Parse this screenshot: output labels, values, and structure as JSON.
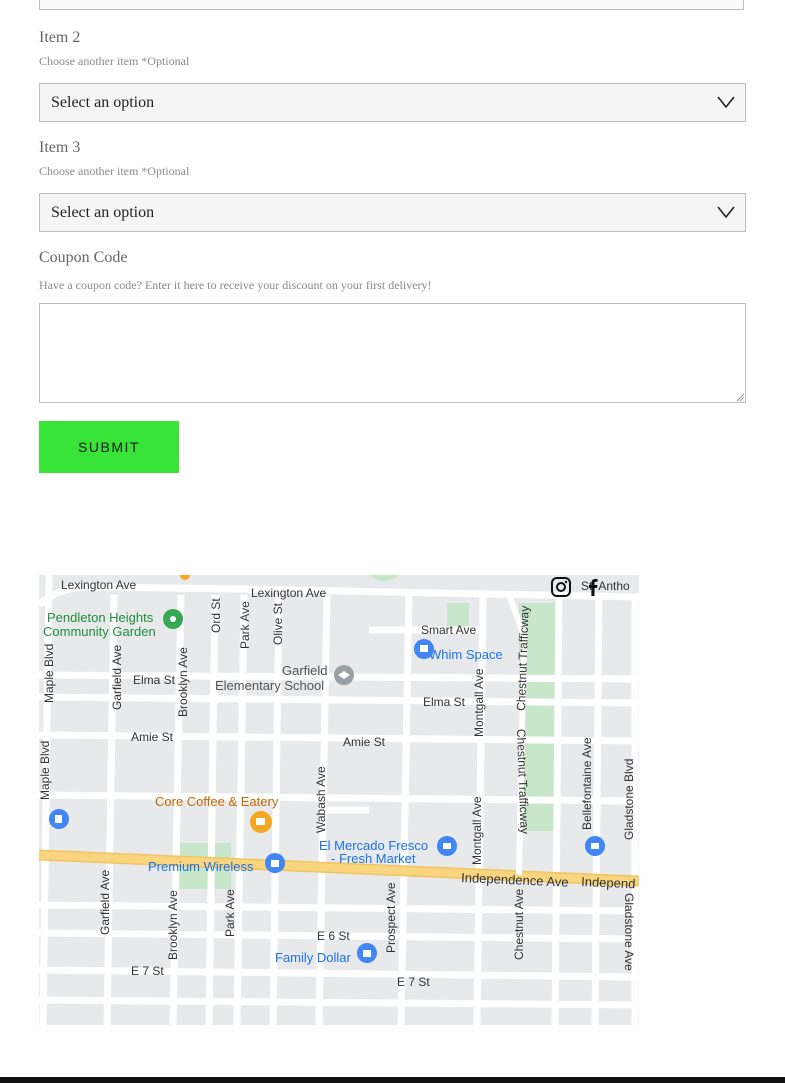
{
  "form": {
    "item2": {
      "label": "Item 2",
      "help": "Choose another item *Optional",
      "value": "Select an option"
    },
    "item3": {
      "label": "Item 3",
      "help": "Choose another item *Optional",
      "value": "Select an option"
    },
    "coupon": {
      "label": "Coupon Code",
      "help": "Have a coupon code? Enter it here to receive your discount on your first delivery!",
      "value": ""
    },
    "submit_label": "SUBMIT"
  },
  "map": {
    "streets": {
      "lexington_1": "Lexington Ave",
      "lexington_2": "Lexington Ave",
      "st_antho": "St. Antho",
      "smart": "Smart Ave",
      "maple_1": "Maple Blvd",
      "maple_2": "Maple Blvd",
      "garfield_1": "Garfield Ave",
      "garfield_2": "Garfield Ave",
      "brooklyn_1": "Brooklyn Ave",
      "brooklyn_2": "Brooklyn Ave",
      "ord": "Ord St",
      "park_1": "Park Ave",
      "park_2": "Park Ave",
      "olive": "Olive St",
      "elma_1": "Elma St",
      "elma_2": "Elma St",
      "amie_1": "Amie St",
      "amie_2": "Amie St",
      "wabash": "Wabash Ave",
      "montgall_1": "Montgall Ave",
      "montgall_2": "Montgall Ave",
      "chestnut_tw_1": "Chestnut Trafficway",
      "chestnut_tw_2": "Chestnut Trafficway",
      "bellefontaine": "Bellefontaine Ave",
      "gladstone_1": "Gladstone Blvd",
      "gladstone_2": "Gladstone Ave",
      "independence_1": "Independence Ave",
      "independence_2": "Independ",
      "prospect": "Prospect Ave",
      "chestnut_ave": "Chestnut Ave",
      "e6": "E 6 St",
      "e7_1": "E 7 St",
      "e7_2": "E 7 St"
    },
    "places": {
      "pendleton_1": "Pendleton Heights",
      "pendleton_2": "Community Garden",
      "whim": "Whim Space",
      "garfield_school_1": "Garfield",
      "garfield_school_2": "Elementary School",
      "core_coffee": "Core Coffee & Eatery",
      "premium_wireless": "Premium Wireless",
      "mercado_1": "El Mercado Fresco",
      "mercado_2": "- Fresh Market",
      "family_dollar": "Family Dollar"
    },
    "colors": {
      "road": "#ffffff",
      "highway": "#f8d57e",
      "park": "#c8e6c9",
      "blue_pin": "#4285f4",
      "green_pin": "#34a853",
      "orange_pin": "#f5a623",
      "gray_pin": "#9aa0a6"
    }
  }
}
